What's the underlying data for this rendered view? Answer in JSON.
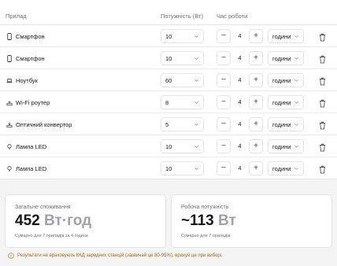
{
  "table": {
    "headers": {
      "device": "Прилад",
      "power": "Потужність (Вт)",
      "hours": "Час роботи"
    },
    "rows": [
      {
        "icon": "smartphone-icon",
        "device": "Смартфон",
        "power": "10",
        "hours": "4",
        "unit": "години"
      },
      {
        "icon": "smartphone-icon",
        "device": "Смартфон",
        "power": "10",
        "hours": "4",
        "unit": "години"
      },
      {
        "icon": "laptop-icon",
        "device": "Ноутбук",
        "power": "60",
        "hours": "4",
        "unit": "години"
      },
      {
        "icon": "wifi-router-icon",
        "device": "Wi-Fi роутер",
        "power": "8",
        "hours": "4",
        "unit": "години"
      },
      {
        "icon": "fiber-converter-icon",
        "device": "Оптичний конвертор",
        "power": "5",
        "hours": "4",
        "unit": "години"
      },
      {
        "icon": "lamp-icon",
        "device": "Лампа LED",
        "power": "10",
        "hours": "4",
        "unit": "години"
      },
      {
        "icon": "lamp-icon",
        "device": "Лампа LED",
        "power": "10",
        "hours": "4",
        "unit": "години"
      }
    ],
    "minus": "−",
    "plus": "+"
  },
  "summary": {
    "total": {
      "label": "Загальне споживання",
      "value": "452",
      "unit": "Вт·год",
      "sub": "Сумарно для 7 приладів за 4 години"
    },
    "peak": {
      "label": "Робоча потужність",
      "value": "~113",
      "unit": "Вт",
      "sub": "Сумарно для 7 приладів"
    }
  },
  "note": "Результати не враховують ККД зарядних станцій (зазвичай це 80-95%), врахуй це при виборі.",
  "colors": {
    "note": "#a86a12",
    "muted": "#71717a",
    "unit": "#a1a1aa"
  }
}
